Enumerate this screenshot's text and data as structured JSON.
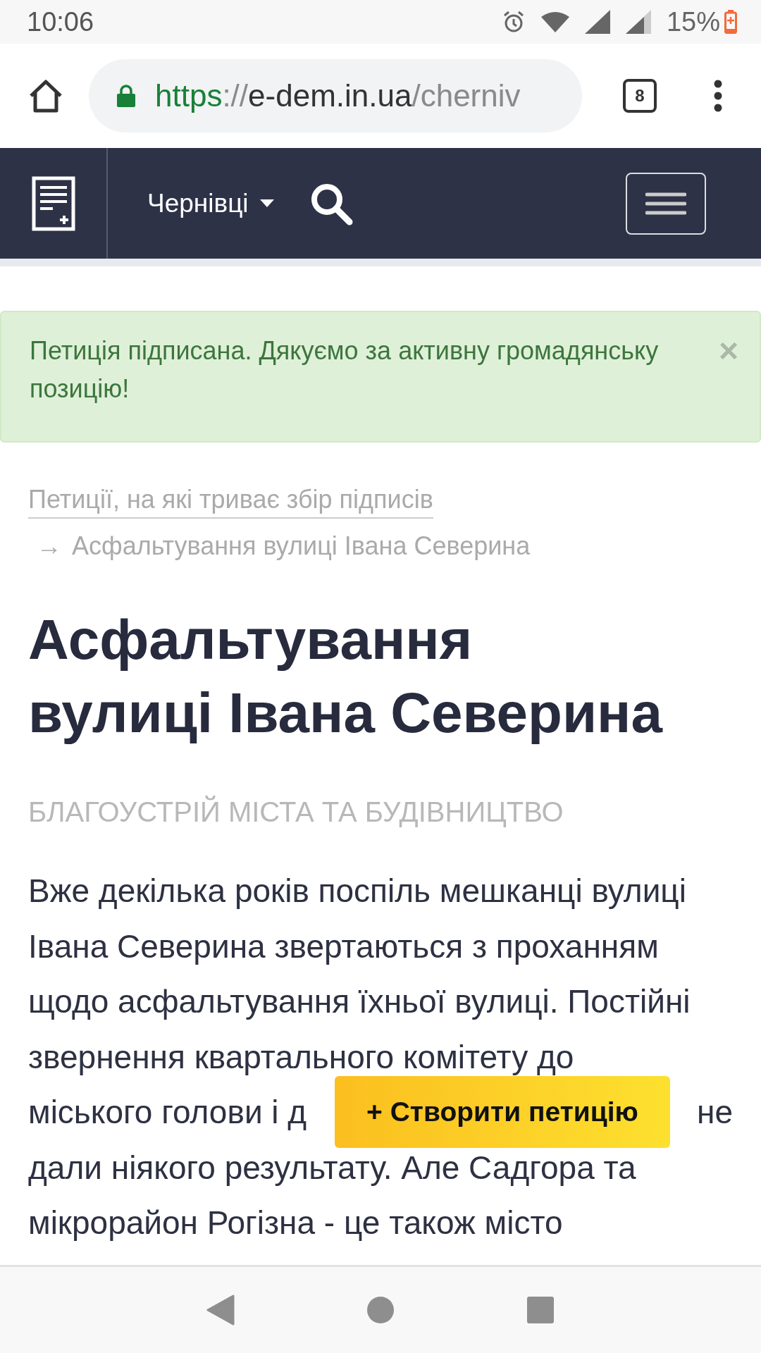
{
  "status_bar": {
    "time": "10:06",
    "battery": "15%"
  },
  "browser": {
    "url": [
      {
        "kind": "scheme",
        "text": "https"
      },
      {
        "kind": "separator",
        "text": "://"
      },
      {
        "kind": "host",
        "text": "e-dem.in.ua"
      },
      {
        "kind": "path",
        "text": "/cherniv"
      }
    ],
    "tab_count": "8"
  },
  "navbar": {
    "city": "Чернівці"
  },
  "alert": {
    "text": "Петиція підписана. Дякуємо за активну громадянську позицію!",
    "close": "×"
  },
  "breadcrumb": {
    "link": "Петиції, на які триває збір підписів",
    "separator": "→",
    "current": "Асфальтування вулиці Івана Северина"
  },
  "title_lines": [
    "Асфальтування",
    "вулиці Івана Северина"
  ],
  "category": "БЛАГОУСТРІЙ МІСТА ТА БУДІВНИЦТВО",
  "body_lines": [
    {
      "text": "Вже декілька років поспіль мешканці вулиці"
    },
    {
      "text": "Івана Северина звертаються з проханням"
    },
    {
      "text": "щодо асфальтування їхньої вулиці. Постійні"
    },
    {
      "text": "звернення квартального комітету до"
    },
    {
      "text": "міського голови і д",
      "text_right": "не"
    },
    {
      "text": "дали ніякого результату. Але Садгора та"
    },
    {
      "text": "мікрорайон Рогізна - це також місто"
    }
  ],
  "create_button": "+ Створити петицію"
}
